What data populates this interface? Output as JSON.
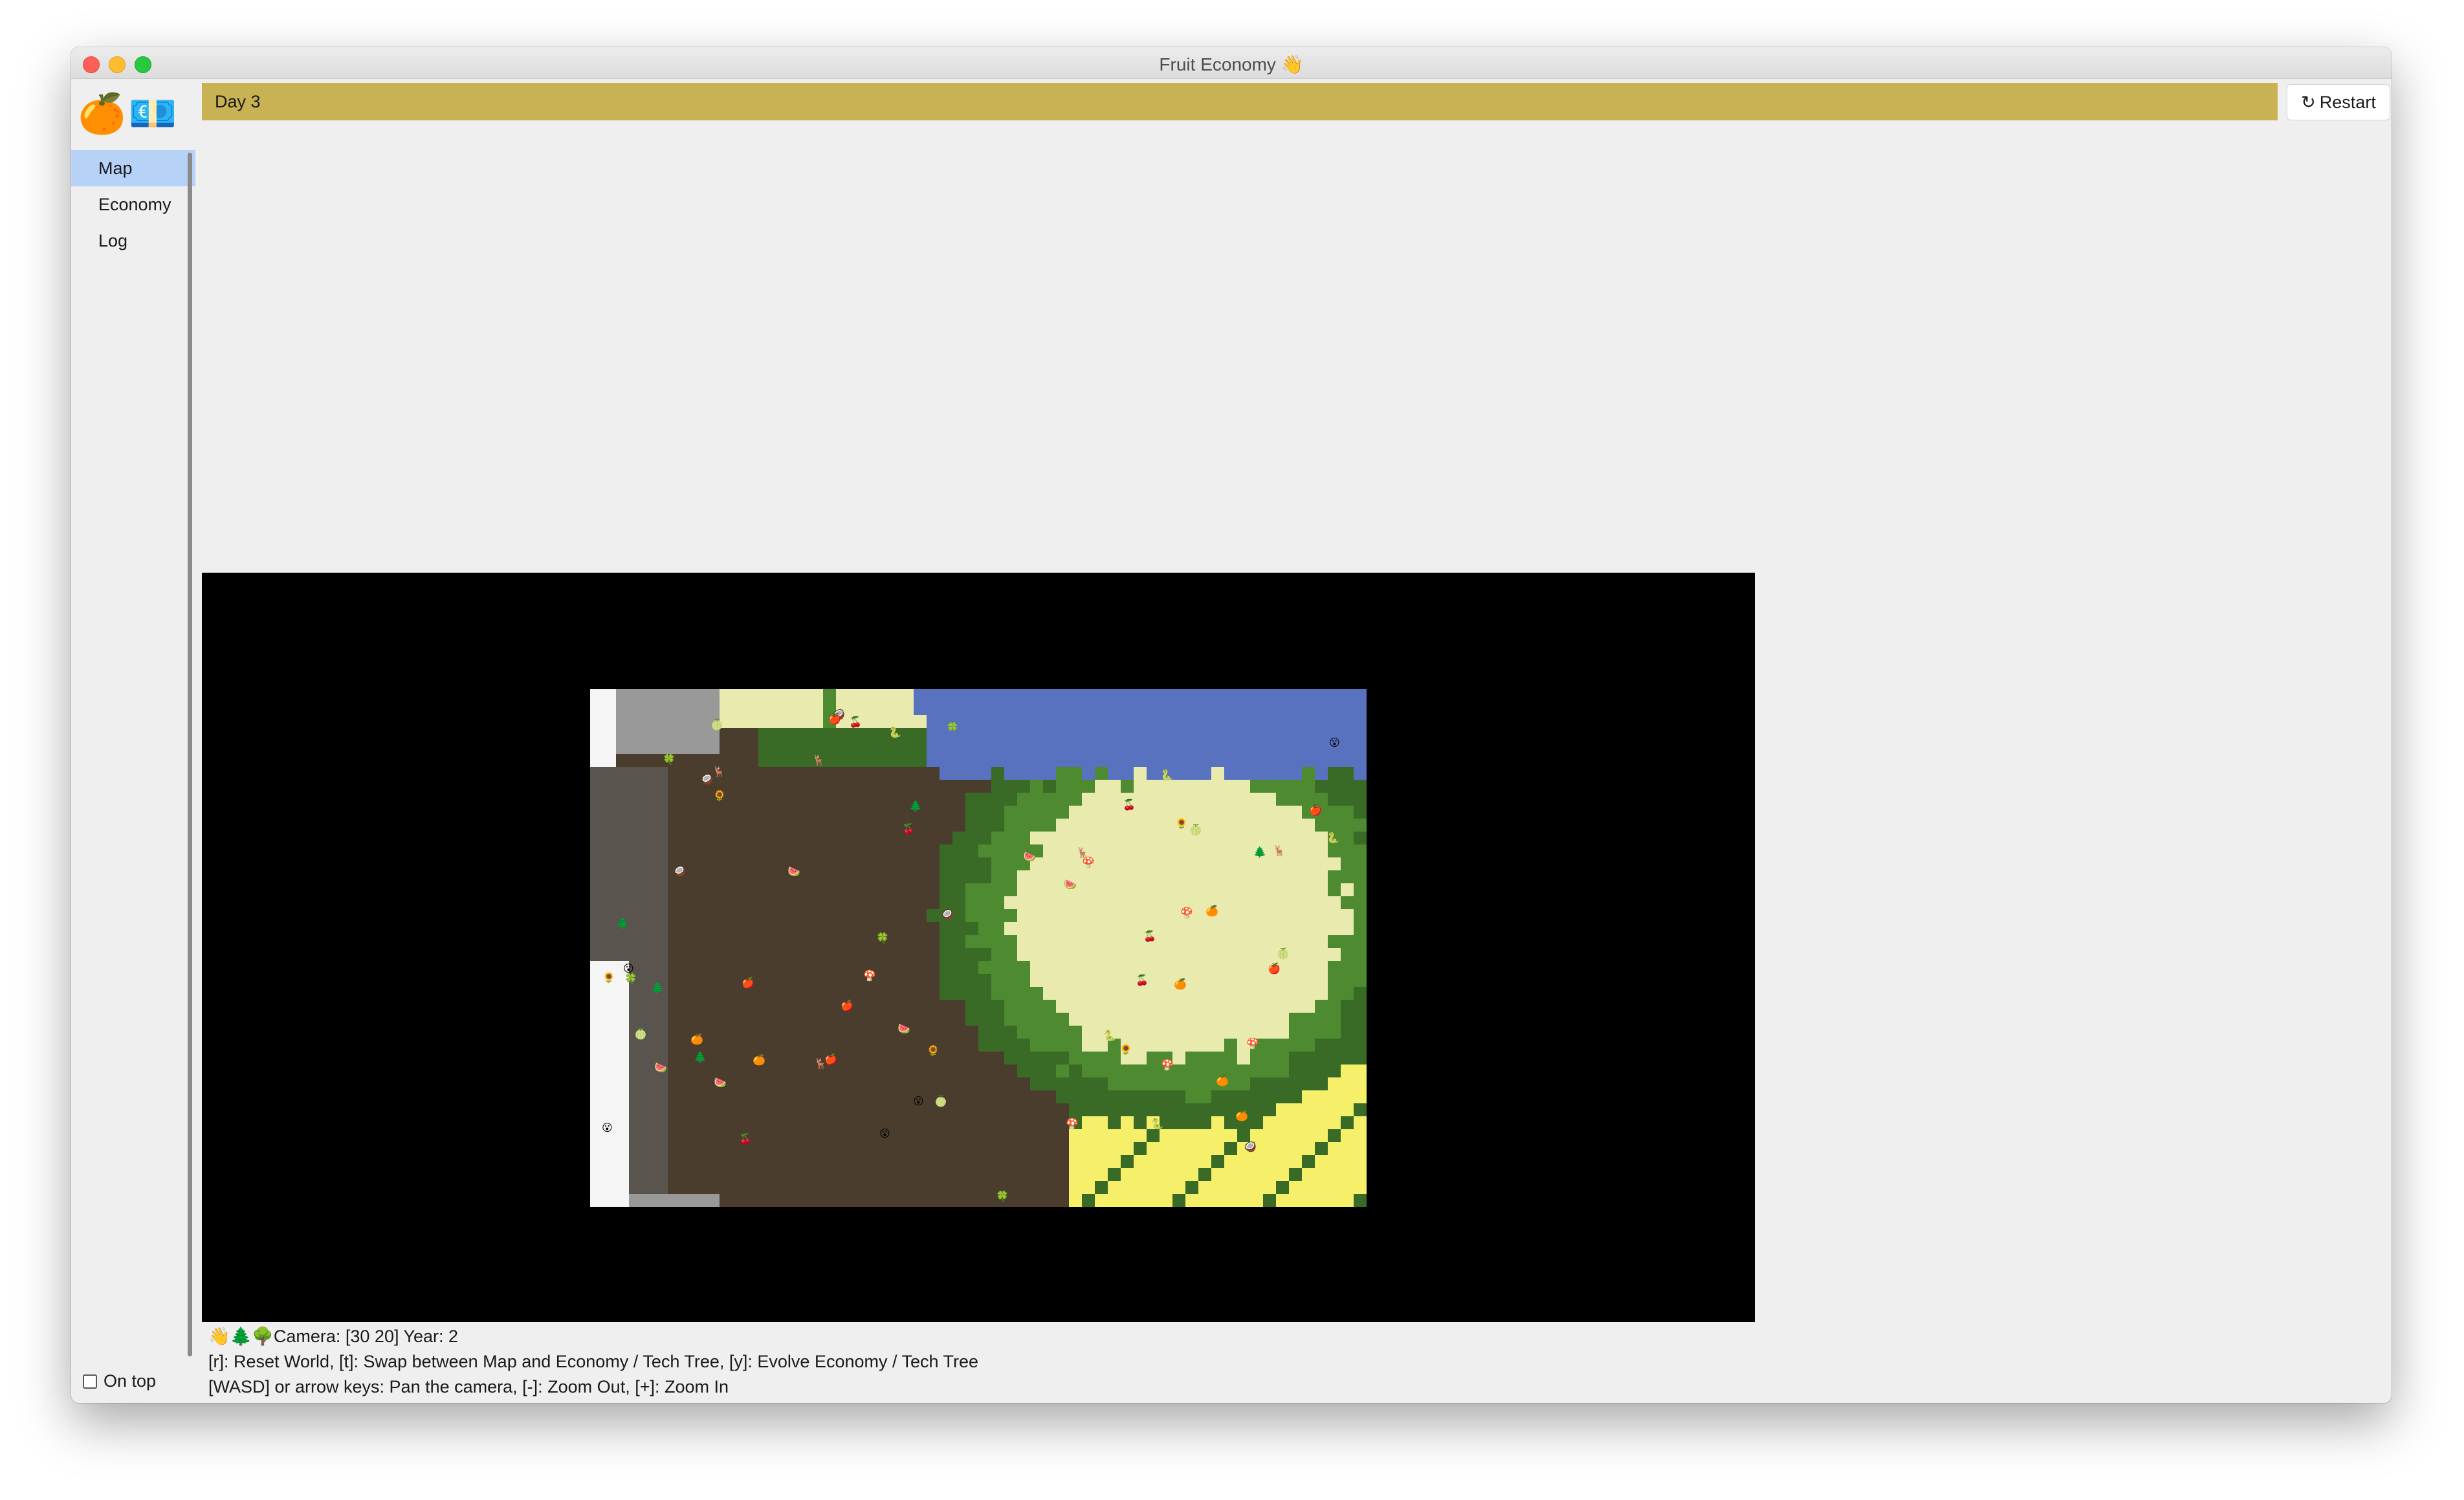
{
  "window": {
    "title": "Fruit Economy 👋"
  },
  "sidebar": {
    "logo_icons": [
      "🍊",
      "💶"
    ],
    "items": [
      {
        "label": "Map",
        "active": true
      },
      {
        "label": "Economy",
        "active": false
      },
      {
        "label": "Log",
        "active": false
      }
    ],
    "on_top_label": "On top"
  },
  "header": {
    "day_label": "Day 3",
    "bar_color": "#c9b253",
    "restart_icon": "↻",
    "restart_label": "Restart"
  },
  "status": {
    "line1": "👋🌲🌳Camera: [30 20] Year: 2",
    "line2": "[r]: Reset World, [t]: Swap between Map and Economy / Tech Tree, [y]: Evolve Economy / Tech Tree",
    "line3": "[WASD] or arrow keys: Pan the camera, [-]: Zoom Out, [+]: Zoom In"
  },
  "map": {
    "terrain_colors": {
      "water": "#5872c0",
      "sand": "#e8eaae",
      "yellow": "#f5ef6a",
      "dark_green": "#3a6b26",
      "green": "#4e8a30",
      "dirt": "#4a3d2e",
      "rock": "#5a544f",
      "stone": "#999999",
      "snow": "#f5f5f5"
    },
    "entities": [
      "🍎",
      "🍊",
      "🍒",
      "🍉",
      "🍄",
      "🌲",
      "🦌",
      "🐍",
      "🥥",
      "🍈",
      "🍀",
      "🌻",
      "😮"
    ]
  }
}
